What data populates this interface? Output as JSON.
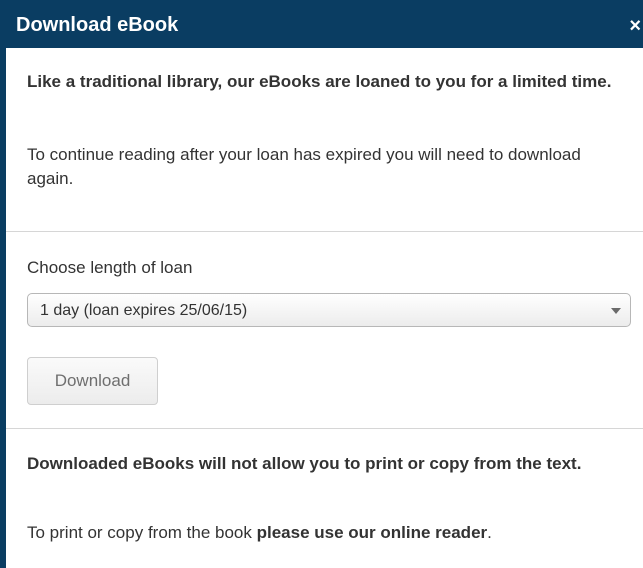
{
  "dialog": {
    "title": "Download eBook",
    "close_glyph": "×"
  },
  "intro": {
    "heading": "Like a traditional library, our eBooks are loaned to you for a limited time.",
    "body": "To continue reading after your loan has expired you will need to download again."
  },
  "loan": {
    "label": "Choose length of loan",
    "selected": "1 day (loan expires 25/06/15)",
    "download_label": "Download"
  },
  "notice": {
    "heading": "Downloaded eBooks will not allow you to print or copy from the text.",
    "body_prefix": "To print or copy from the book ",
    "body_emphasis": "please use our online reader",
    "body_suffix": "."
  },
  "icons": {
    "close": "close-icon",
    "dropdown": "chevron-down-icon"
  },
  "colors": {
    "header_bg": "#0a3d62",
    "header_text": "#ffffff",
    "body_text": "#333333",
    "divider": "#d6d6d6"
  }
}
